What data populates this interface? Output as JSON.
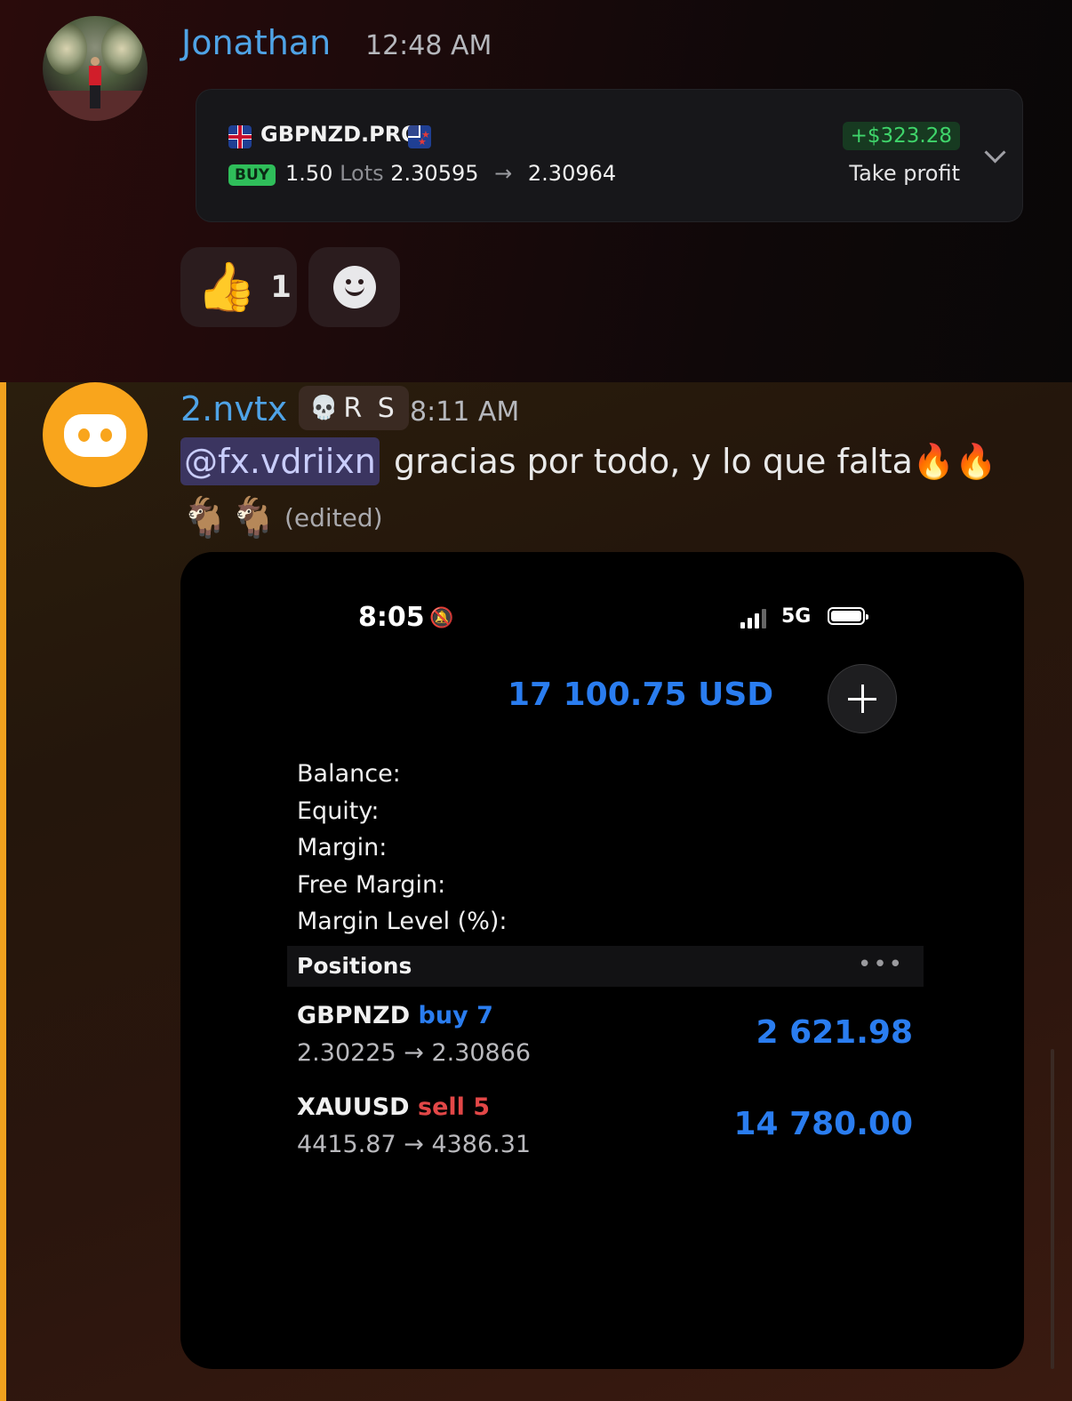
{
  "message1": {
    "username": "Jonathan",
    "username_color": "#4fa3e6",
    "timestamp": "12:48 AM",
    "trade_card": {
      "symbol": "GBPNZD.PRO",
      "side": "BUY",
      "lots_value": "1.50",
      "lots_word": "Lots",
      "open_price": "2.30595",
      "close_price": "2.30964",
      "profit": "+$323.28",
      "result": "Take profit"
    },
    "reactions": [
      {
        "emoji": "👍",
        "count": "1"
      }
    ]
  },
  "message2": {
    "username": "2.nvtx",
    "username_color": "#4fa3e6",
    "role_tag": "R S",
    "timestamp": "8:11 AM",
    "mention": "@fx.vdriixn",
    "text": "gracias por todo, y lo que falta🔥🔥",
    "emoji_line": "🐐🐐",
    "edited": "(edited)",
    "accent_color": "#f0a11e",
    "screenshot": {
      "status_time": "8:05",
      "network": "5G",
      "equity_header": "17 100.75 USD",
      "account_labels": [
        "Balance:",
        "Equity:",
        "Margin:",
        "Free Margin:",
        "Margin Level (%):"
      ],
      "positions_title": "Positions",
      "positions": [
        {
          "symbol": "GBPNZD",
          "side": "buy 7",
          "prices": "2.30225 → 2.30866",
          "profit": "2 621.98"
        },
        {
          "symbol": "XAUUSD",
          "side": "sell 5",
          "prices": "4415.87 → 4386.31",
          "profit": "14 780.00"
        }
      ]
    }
  }
}
